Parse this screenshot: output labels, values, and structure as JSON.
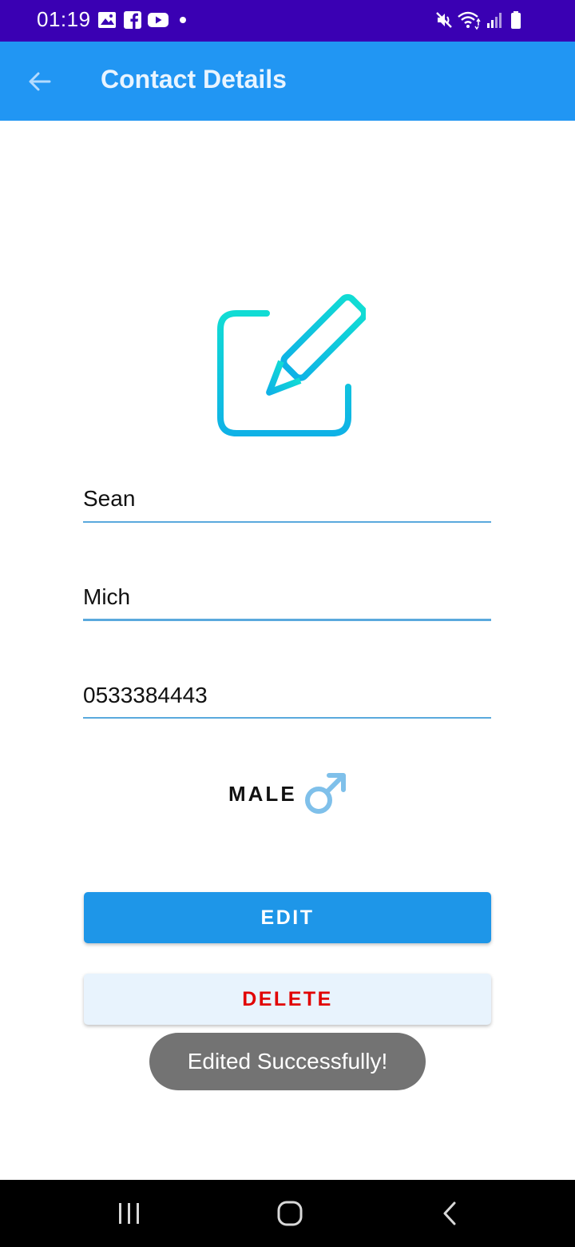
{
  "status_bar": {
    "time": "01:19",
    "left_icons": [
      "image-icon",
      "facebook-icon",
      "youtube-icon",
      "dot-icon"
    ],
    "right_icons": [
      "mute-icon",
      "wifi-icon",
      "signal-icon",
      "battery-icon"
    ]
  },
  "app_bar": {
    "title": "Contact Details",
    "back_icon": "arrow-left-icon",
    "background": "#2196f3"
  },
  "hero": {
    "icon": "edit-icon"
  },
  "form": {
    "first_name": "Sean",
    "last_name": "Mich",
    "phone": "0533384443"
  },
  "gender": {
    "label": "MALE",
    "icon": "male-symbol-icon"
  },
  "buttons": {
    "edit_label": "EDIT",
    "delete_label": "DELETE"
  },
  "toast": {
    "message": "Edited Successfully!"
  },
  "nav_bar": {
    "items": [
      "recent-apps-icon",
      "home-icon",
      "back-icon"
    ]
  },
  "colors": {
    "status_bar": "#3a00b3",
    "accent": "#2196f3",
    "delete_text": "#e10000"
  }
}
